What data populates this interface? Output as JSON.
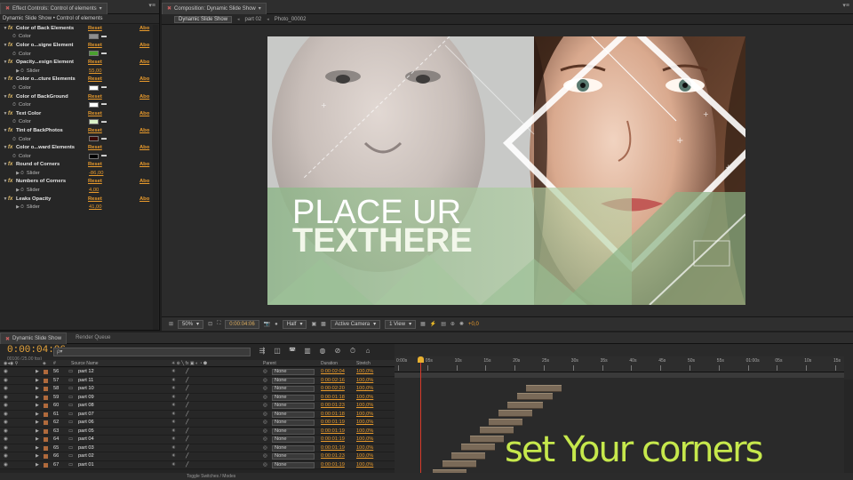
{
  "effect_panel": {
    "tab_title": "Effect Controls: Control of elements",
    "subhead": "Dynamic Slide Show • Control of elements",
    "reset_label": "Reset",
    "about_label": "Abo",
    "effects": [
      {
        "name": "Color of Back Elements",
        "param": "Color",
        "kind": "color",
        "swatch": "#8e8e8e"
      },
      {
        "name": "Color o...signe Element",
        "param": "Color",
        "kind": "color",
        "swatch": "#4aa030"
      },
      {
        "name": "Opacity...esign Element",
        "param": "Slider",
        "kind": "slider",
        "value": "55,00"
      },
      {
        "name": "Color o...cture Elements",
        "param": "Color",
        "kind": "color",
        "swatch": "#ffffff"
      },
      {
        "name": "Color of BackGround",
        "param": "Color",
        "kind": "color",
        "swatch": "#ffffff"
      },
      {
        "name": "Text Color",
        "param": "Color",
        "kind": "color",
        "swatch": "#d9f2c8"
      },
      {
        "name": "Tint of BackPhotos",
        "param": "Color",
        "kind": "color",
        "swatch": "#3a0a08"
      },
      {
        "name": "Color o...ward Elements",
        "param": "Color",
        "kind": "color",
        "swatch": "#000000"
      },
      {
        "name": "Round of Corners",
        "param": "Slider",
        "kind": "slider",
        "value": "-86,00"
      },
      {
        "name": "Numbers of Corners",
        "param": "Slider",
        "kind": "slider",
        "value": "4,00"
      },
      {
        "name": "Leaks Opacity",
        "param": "Slider",
        "kind": "slider",
        "value": "41,00"
      }
    ]
  },
  "comp_panel": {
    "tab_title": "Composition: Dynamic Slide Show",
    "crumbs": [
      "Dynamic Slide Show",
      "part 02",
      "Photo_00002"
    ],
    "frame_text_line1": "PLACE UR",
    "frame_text_line2": "TEXTHERE",
    "toolbar": {
      "zoom": "50%",
      "timecode": "0:00:04:06",
      "resolution": "Half",
      "camera": "Active Camera",
      "view": "1 View",
      "exposure": "+0,0"
    }
  },
  "timeline": {
    "tabs": [
      "Dynamic Slide Show",
      "Render Queue"
    ],
    "current_time": "0:00:04:06",
    "fps": "00106 (25.00 fps)",
    "search_placeholder": "ρ▾",
    "columns": {
      "number": "#",
      "source": "Source Name",
      "parent": "Parent",
      "duration": "Duration",
      "stretch": "Stretch"
    },
    "layers": [
      {
        "num": "56",
        "name": "part 12",
        "parent": "None",
        "duration": "0:00:02:04",
        "stretch": "100,0%"
      },
      {
        "num": "57",
        "name": "part 11",
        "parent": "None",
        "duration": "0:00:02:16",
        "stretch": "100,0%"
      },
      {
        "num": "58",
        "name": "part 10",
        "parent": "None",
        "duration": "0:00:02:20",
        "stretch": "100,0%"
      },
      {
        "num": "59",
        "name": "part 09",
        "parent": "None",
        "duration": "0:00:01:18",
        "stretch": "100,0%"
      },
      {
        "num": "60",
        "name": "part 08",
        "parent": "None",
        "duration": "0:00:01:23",
        "stretch": "100,0%"
      },
      {
        "num": "61",
        "name": "part 07",
        "parent": "None",
        "duration": "0:00:01:18",
        "stretch": "100,0%"
      },
      {
        "num": "62",
        "name": "part 06",
        "parent": "None",
        "duration": "0:00:01:19",
        "stretch": "100,0%"
      },
      {
        "num": "63",
        "name": "part 05",
        "parent": "None",
        "duration": "0:00:01:19",
        "stretch": "100,0%"
      },
      {
        "num": "64",
        "name": "part 04",
        "parent": "None",
        "duration": "0:00:01:19",
        "stretch": "100,0%"
      },
      {
        "num": "65",
        "name": "part 03",
        "parent": "None",
        "duration": "0:00:01:19",
        "stretch": "100,0%"
      },
      {
        "num": "66",
        "name": "part 02",
        "parent": "None",
        "duration": "0:00:01:23",
        "stretch": "100,0%"
      },
      {
        "num": "67",
        "name": "part 01",
        "parent": "None",
        "duration": "0:00:01:19",
        "stretch": "100,0%"
      }
    ],
    "ruler_labels": [
      "0:00s",
      "05s",
      "10s",
      "15s",
      "20s",
      "25s",
      "30s",
      "35s",
      "40s",
      "45s",
      "50s",
      "55s",
      "01:00s",
      "05s",
      "10s",
      "15s"
    ],
    "toggle_label": "Toggle Switches / Modes"
  },
  "caption": "set Your corners",
  "colors": {
    "accent_orange": "#e89a2c",
    "caption_green": "#c6e84c",
    "playhead": "#d83a2a"
  }
}
